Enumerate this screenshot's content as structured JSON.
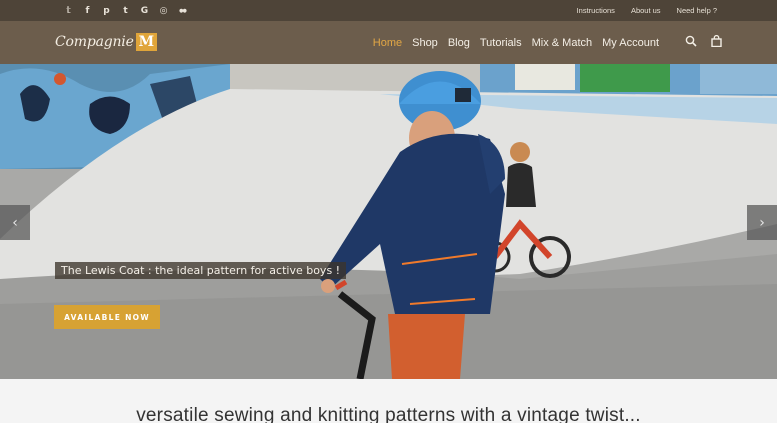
{
  "topbar": {
    "social": [
      {
        "icon": "twitter-icon",
        "glyph": "𝕥"
      },
      {
        "icon": "facebook-icon",
        "glyph": "f"
      },
      {
        "icon": "pinterest-icon",
        "glyph": "p"
      },
      {
        "icon": "tumblr-icon",
        "glyph": "t"
      },
      {
        "icon": "google-plus-icon",
        "glyph": "G"
      },
      {
        "icon": "instagram-icon",
        "glyph": "◎"
      },
      {
        "icon": "flickr-icon",
        "glyph": "●●"
      }
    ],
    "links": [
      "Instructions",
      "About us",
      "Need help ?"
    ]
  },
  "header": {
    "logo_text": "Compagnie",
    "logo_mark": "M",
    "nav": [
      "Home",
      "Shop",
      "Blog",
      "Tutorials",
      "Mix & Match",
      "My Account"
    ],
    "active_nav": "Home"
  },
  "hero": {
    "caption": "The Lewis Coat : the ideal pattern for active boys !",
    "cta_label": "AVAILABLE NOW",
    "prev_glyph": "‹",
    "next_glyph": "›"
  },
  "tagline": "versatile sewing and knitting patterns with a vintage twist...",
  "colors": {
    "topbar": "#4e4438",
    "header": "#6c5d4c",
    "accent": "#d7a233",
    "nav_active": "#e2a745"
  }
}
